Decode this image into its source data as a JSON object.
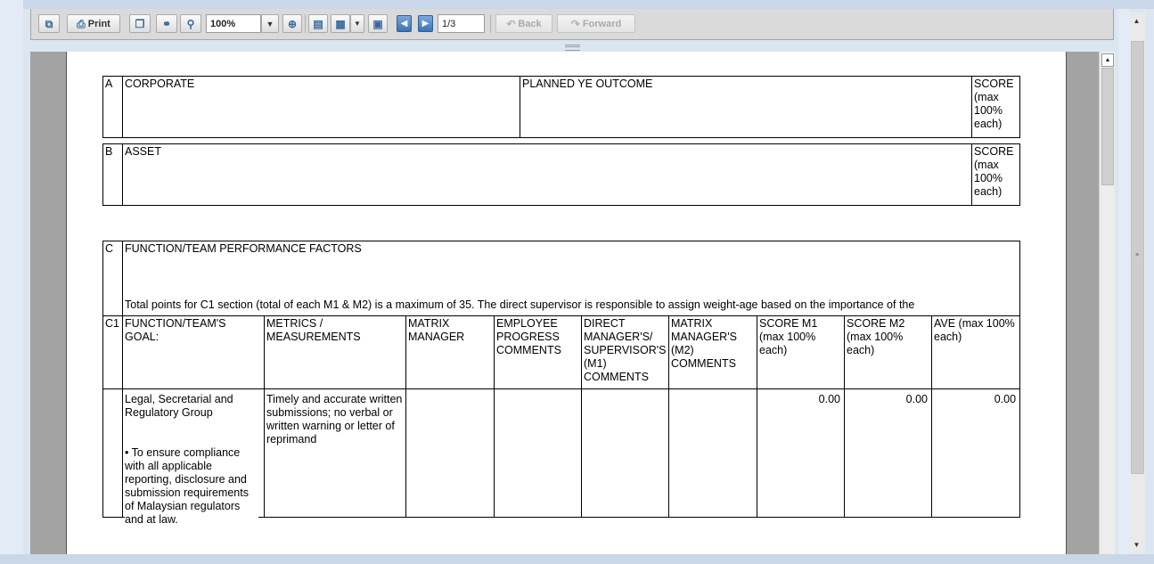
{
  "toolbar": {
    "print_label": "Print",
    "zoom": "100%",
    "page_indicator": "1/3",
    "back_label": "Back",
    "forward_label": "Forward"
  },
  "section_a": {
    "letter": "A",
    "title": "CORPORATE",
    "planned": "PLANNED YE OUTCOME",
    "score": "SCORE (max 100% each)"
  },
  "section_b": {
    "letter": "B",
    "title": "ASSET",
    "score": "SCORE (max 100% each)"
  },
  "section_c": {
    "letter": "C",
    "title": "FUNCTION/TEAM PERFORMANCE FACTORS",
    "note": "Total points for C1 section (total of each M1 & M2) is a maximum of 35. The direct supervisor is responsible to assign weight-age based on the importance of the",
    "headers": [
      "C1",
      "FUNCTION/TEAM'S GOAL:",
      "METRICS / MEASUREMENTS",
      "MATRIX MANAGER",
      "EMPLOYEE PROGRESS COMMENTS",
      "DIRECT MANAGER'S/ SUPERVISOR'S (M1) COMMENTS",
      "MATRIX MANAGER'S (M2) COMMENTS",
      "SCORE M1 (max 100% each)",
      "SCORE M2 (max 100% each)",
      "AVE (max 100% each)"
    ],
    "row": {
      "goal_title": "Legal, Secretarial and Regulatory Group",
      "goal_bullet": "• To ensure compliance with all applicable reporting, disclosure and submission requirements of Malaysian regulators and at law.",
      "metrics": "Timely and accurate written submissions; no verbal or written warning or letter of reprimand",
      "score_m1": "0.00",
      "score_m2": "0.00",
      "ave": "0.00"
    }
  }
}
